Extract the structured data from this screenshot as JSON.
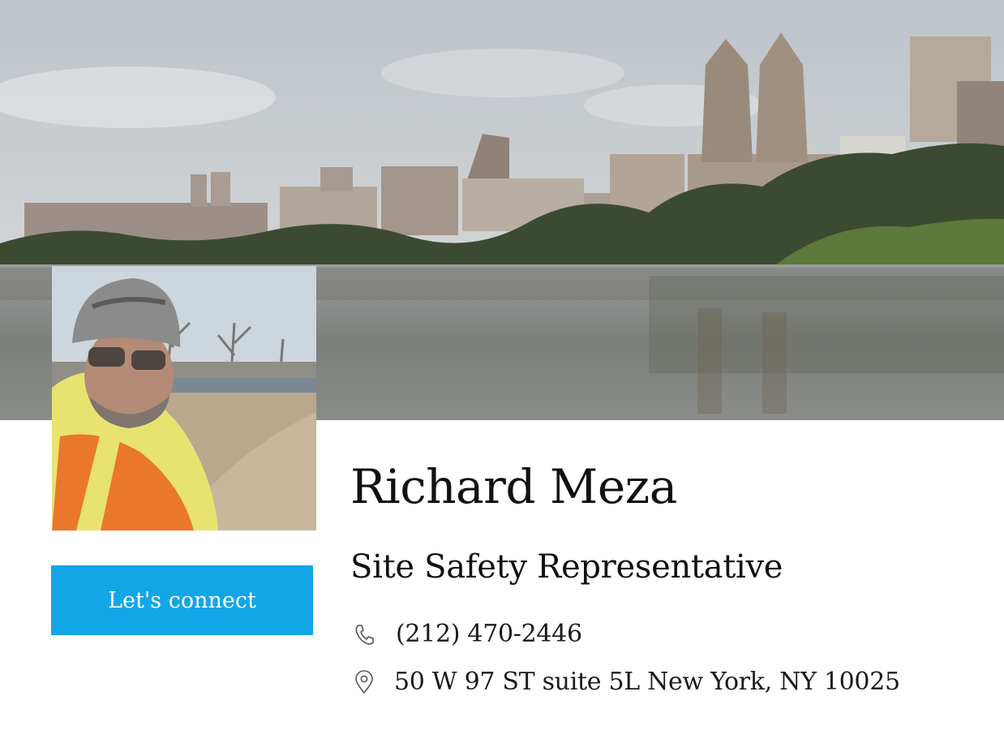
{
  "profile": {
    "name": "Richard Meza",
    "title": "Site Safety Representative",
    "phone": "(212) 470-2446",
    "address": "50 W 97 ST suite 5L New York, NY 10025"
  },
  "actions": {
    "connect_label": "Let's connect"
  },
  "icons": {
    "phone": "phone-icon",
    "location": "map-pin-icon"
  },
  "colors": {
    "button": "#13a6e6",
    "text": "#111111"
  }
}
